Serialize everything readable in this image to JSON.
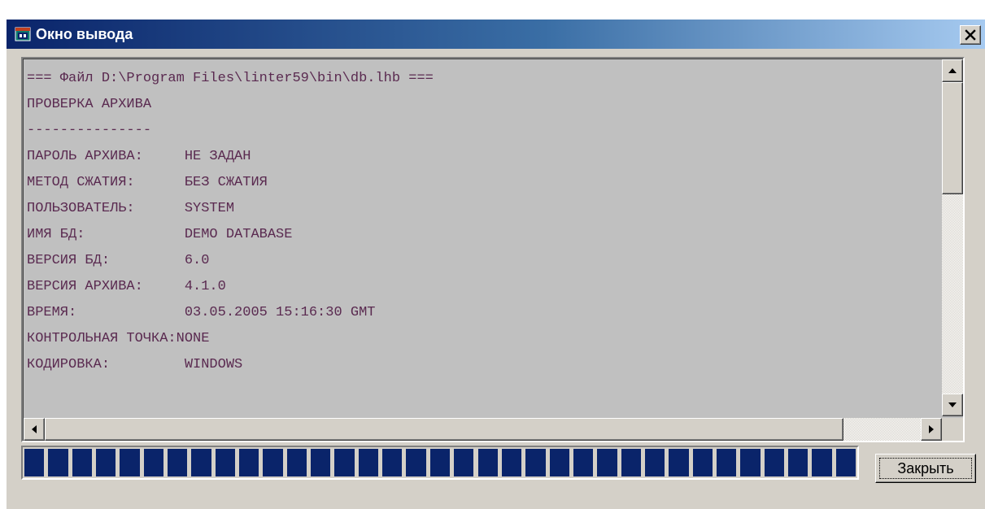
{
  "window": {
    "title": "Окно вывода",
    "close_glyph": "✕"
  },
  "output": {
    "lines": [
      "=== Файл D:\\Program Files\\linter59\\bin\\db.lhb ===",
      "ПРОВЕРКА АРХИВА",
      "---------------",
      "ПАРОЛЬ АРХИВА:     НЕ ЗАДАН",
      "МЕТОД СЖАТИЯ:      БЕЗ СЖАТИЯ",
      "ПОЛЬЗОВАТЕЛЬ:      SYSTEM",
      "ИМЯ БД:            DEMO DATABASE",
      "ВЕРСИЯ БД:         6.0",
      "ВЕРСИЯ АРХИВА:     4.1.0",
      "ВРЕМЯ:             03.05.2005 15:16:30 GMT",
      "КОНТРОЛЬНАЯ ТОЧКА:NONE",
      "КОДИРОВКА:         WINDOWS"
    ]
  },
  "progress": {
    "value": 1.0,
    "segments": 35,
    "color": "#0a246a"
  },
  "buttons": {
    "close_label": "Закрыть"
  },
  "colors": {
    "text": "#5a2a50",
    "face": "#d4d0c8",
    "text_bg": "#c0c0c0"
  }
}
